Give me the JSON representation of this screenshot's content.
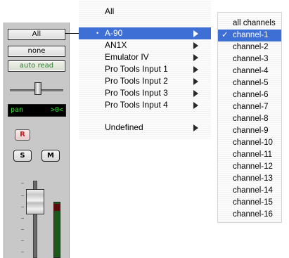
{
  "strip": {
    "output_button": "All",
    "group_button": "none",
    "automation_button": "auto read",
    "pan_display": {
      "label": "pan",
      "value": ">0<"
    },
    "record_button": "R",
    "solo_button": "S",
    "mute_button": "M"
  },
  "device_menu": {
    "header": "All",
    "selected_index": 0,
    "items": [
      {
        "label": "A-90",
        "has_submenu": true
      },
      {
        "label": "AN1X",
        "has_submenu": true
      },
      {
        "label": "Emulator IV",
        "has_submenu": true
      },
      {
        "label": "Pro Tools Input 1",
        "has_submenu": true
      },
      {
        "label": "Pro Tools Input 2",
        "has_submenu": true
      },
      {
        "label": "Pro Tools Input 3",
        "has_submenu": true
      },
      {
        "label": "Pro Tools Input 4",
        "has_submenu": true
      },
      {
        "label": "Undefined",
        "has_submenu": true
      }
    ],
    "bullet": "•"
  },
  "channel_menu": {
    "checkmark": "✓",
    "selected_index": 1,
    "items": [
      "all channels",
      "channel-1",
      "channel-2",
      "channel-3",
      "channel-4",
      "channel-5",
      "channel-6",
      "channel-7",
      "channel-8",
      "channel-9",
      "channel-10",
      "channel-11",
      "channel-12",
      "channel-13",
      "channel-14",
      "channel-15",
      "channel-16"
    ]
  },
  "colors": {
    "highlight": "#3d6fd4",
    "pan_text": "#2fe02f",
    "record_text": "#c02020",
    "auto_text": "#2f7a2f"
  }
}
